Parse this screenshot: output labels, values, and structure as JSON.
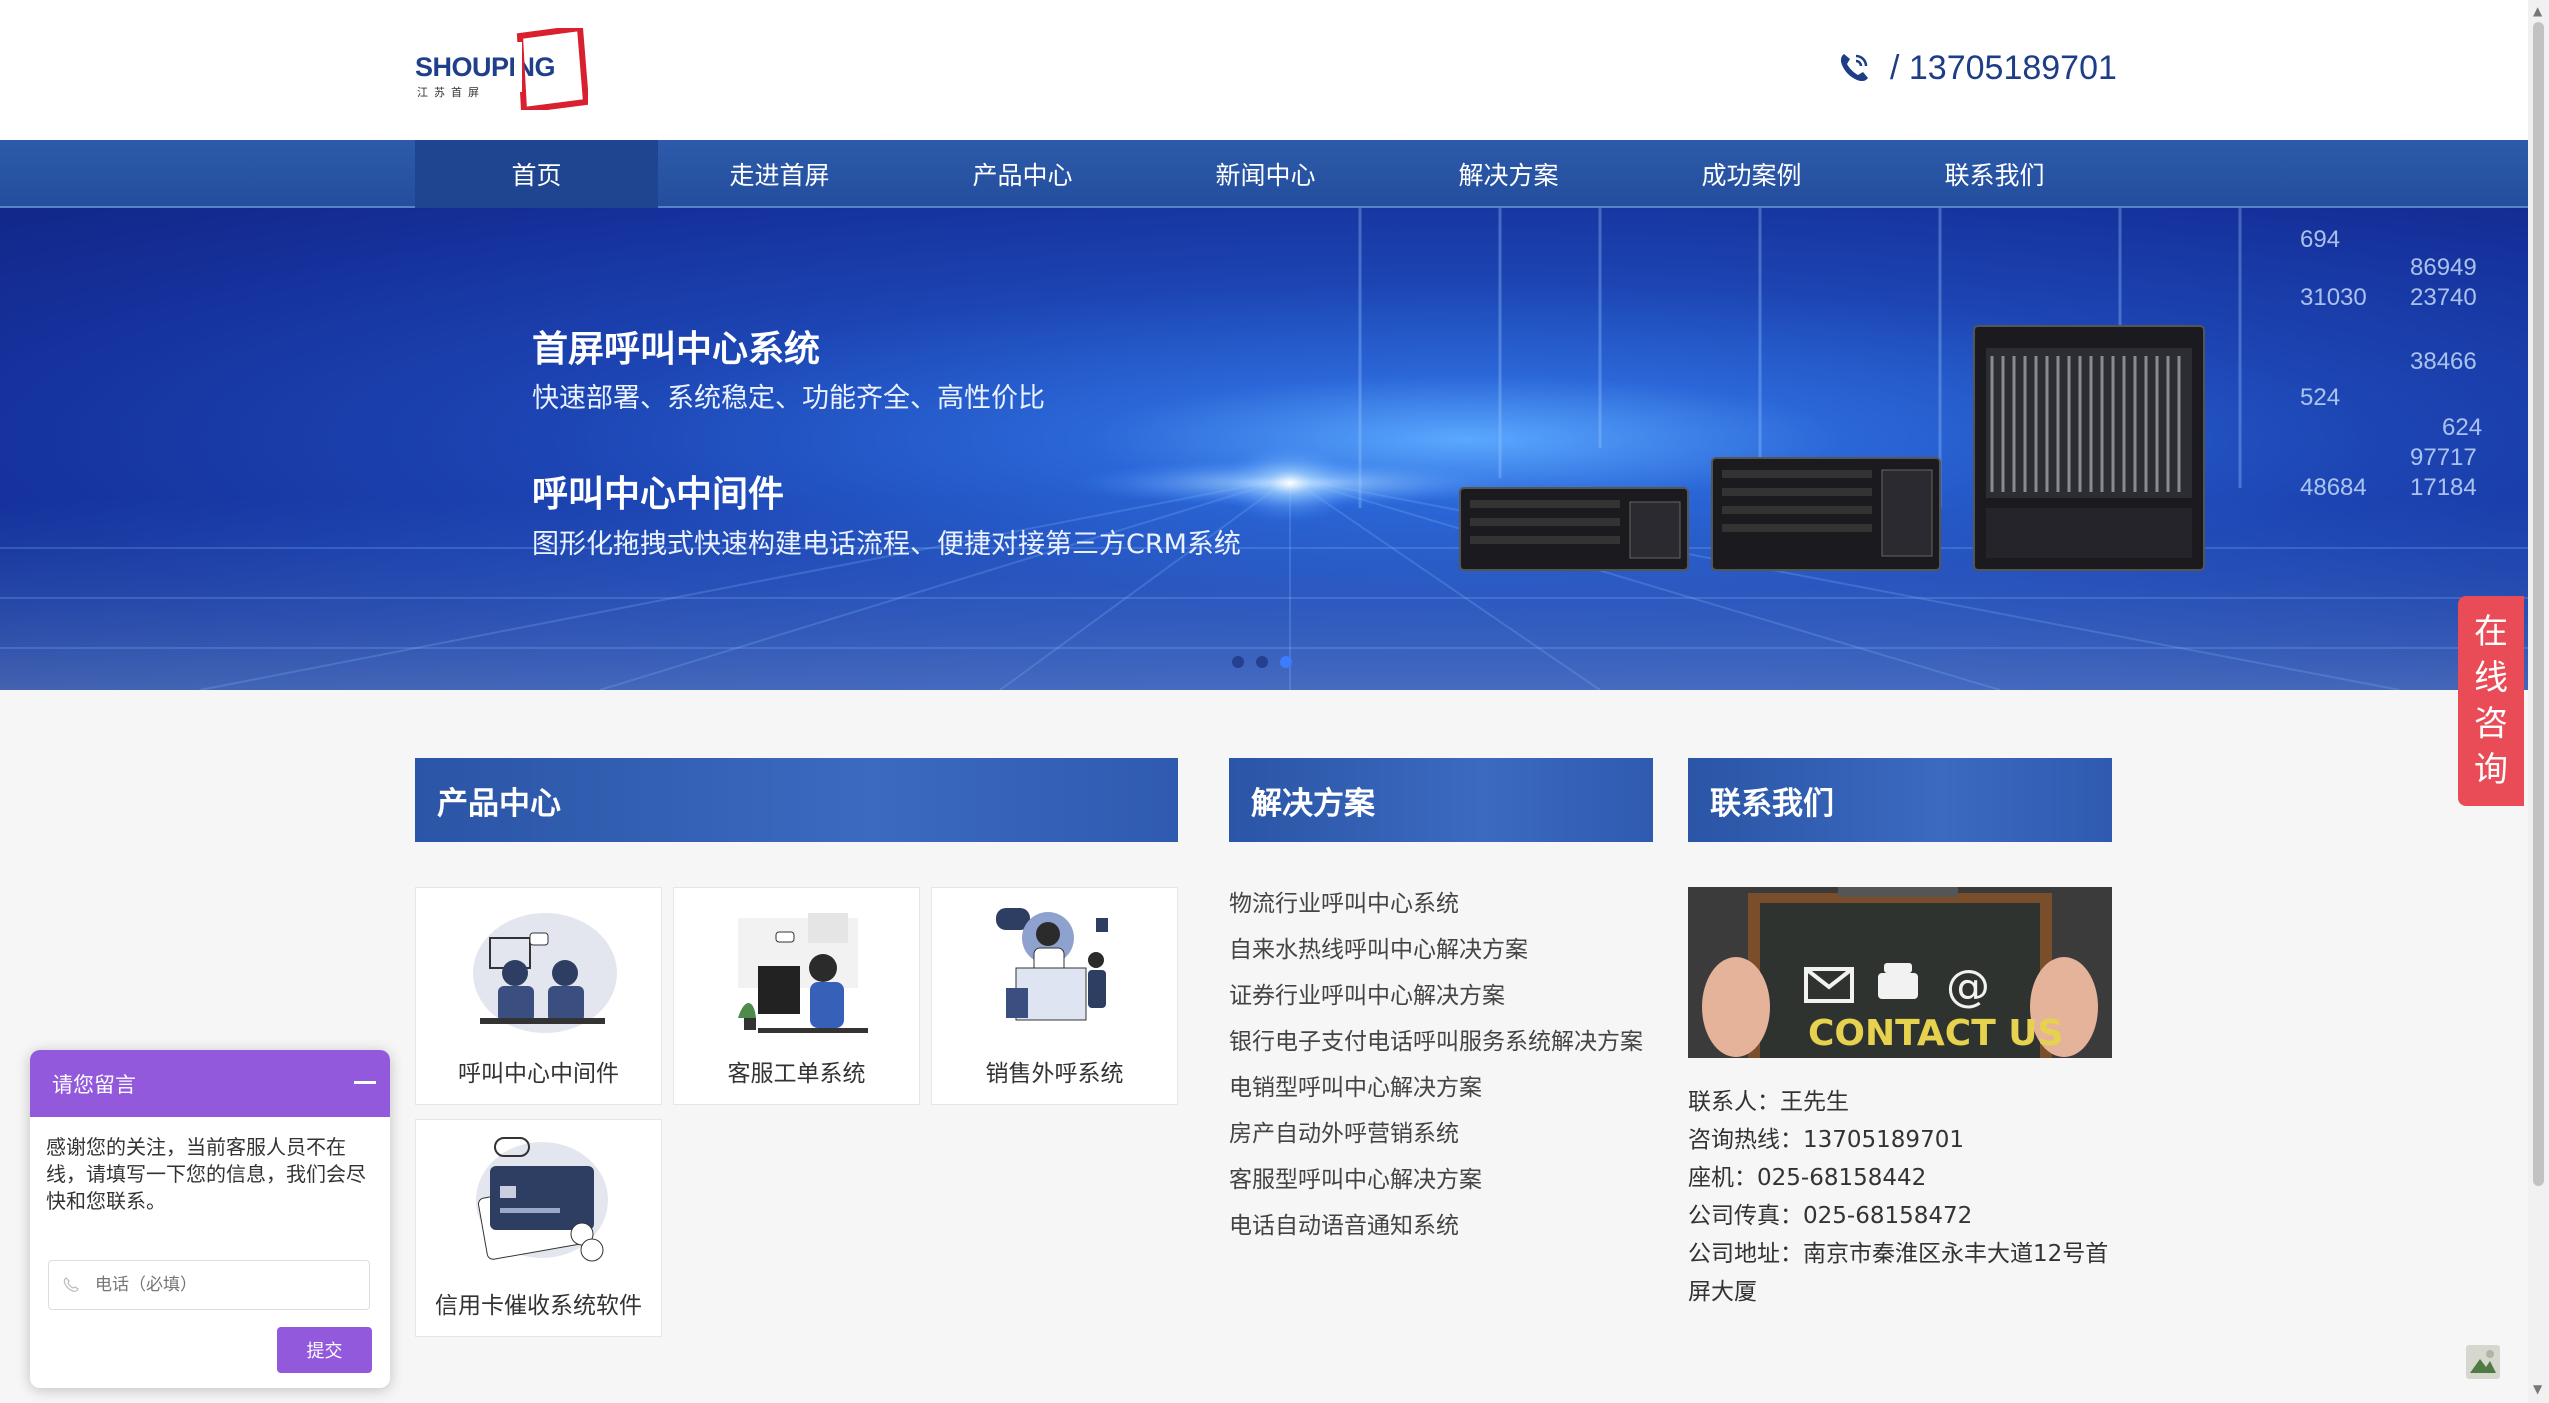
{
  "header": {
    "logo_text": "SHOUPING",
    "logo_sub": "江苏首屏",
    "phone": "/ 13705189701"
  },
  "nav": {
    "items": [
      "首页",
      "走进首屏",
      "产品中心",
      "新闻中心",
      "解决方案",
      "成功案例",
      "联系我们"
    ],
    "active_index": 0
  },
  "banner": {
    "title1": "首屏呼叫中心系统",
    "sub1": "快速部署、系统稳定、功能齐全、高性价比",
    "title2": "呼叫中心中间件",
    "sub2": "图形化拖拽式快速构建电话流程、便捷对接第三方CRM系统",
    "numbers": [
      "694",
      "86949",
      "31030",
      "23740",
      "38466",
      "524",
      "624",
      "97717",
      "48684",
      "17184"
    ],
    "dots_count": 3,
    "active_dot": 2
  },
  "products": {
    "title": "产品中心",
    "items": [
      "呼叫中心中间件",
      "客服工单系统",
      "销售外呼系统",
      "信用卡催收系统软件"
    ]
  },
  "solutions": {
    "title": "解决方案",
    "items": [
      "物流行业呼叫中心系统",
      "自来水热线呼叫中心解决方案",
      "证券行业呼叫中心解决方案",
      "银行电子支付电话呼叫服务系统解决方案",
      "电销型呼叫中心解决方案",
      "房产自动外呼营销系统",
      "客服型呼叫中心解决方案",
      "电话自动语音通知系统"
    ]
  },
  "contact": {
    "title": "联系我们",
    "image_text": "CONTACT US",
    "person": "联系人：王先生",
    "hotline": "咨询热线：13705189701",
    "landline": "座机：025-68158442",
    "fax": "公司传真：025-68158472",
    "address": "公司地址：南京市秦淮区永丰大道12号首屏大厦"
  },
  "consult_tab": {
    "chars": [
      "在",
      "线",
      "咨",
      "询"
    ]
  },
  "chat": {
    "title": "请您留言",
    "message": "感谢您的关注，当前客服人员不在线，请填写一下您的信息，我们会尽快和您联系。",
    "phone_placeholder": "电话（必填）",
    "submit_label": "提交"
  },
  "colors": {
    "nav": "#2d5aaa",
    "nav_active": "#1f4590",
    "consult": "#e94b57",
    "chat_accent": "#9359dd"
  }
}
